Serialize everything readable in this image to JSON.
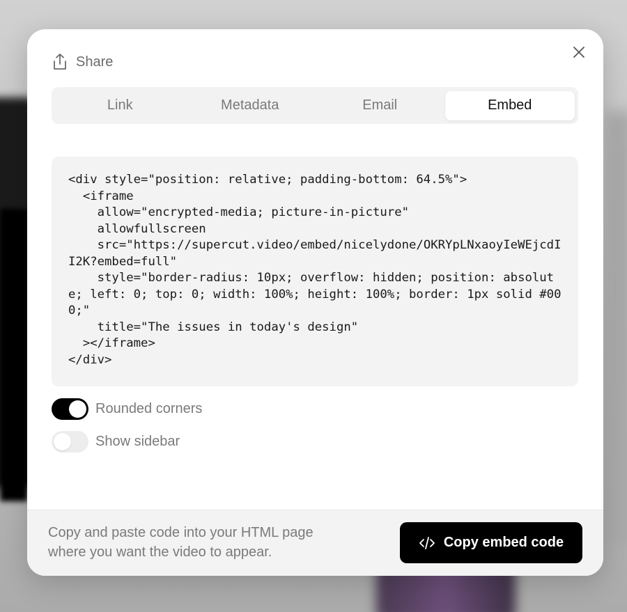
{
  "header": {
    "title": "Share",
    "icon": "share-icon"
  },
  "tabs": [
    {
      "label": "Link",
      "active": false
    },
    {
      "label": "Metadata",
      "active": false
    },
    {
      "label": "Email",
      "active": false
    },
    {
      "label": "Embed",
      "active": true
    }
  ],
  "embed": {
    "code": "<div style=\"position: relative; padding-bottom: 64.5%\">\n  <iframe\n    allow=\"encrypted-media; picture-in-picture\"\n    allowfullscreen\n    src=\"https://supercut.video/embed/nicelydone/OKRYpLNxaoyIeWEjcdII2K?embed=full\"\n    style=\"border-radius: 10px; overflow: hidden; position: absolute; left: 0; top: 0; width: 100%; height: 100%; border: 1px solid #000;\"\n    title=\"The issues in today's design\"\n  ></iframe>\n</div>"
  },
  "options": {
    "rounded_corners": {
      "label": "Rounded corners",
      "enabled": true
    },
    "show_sidebar": {
      "label": "Show sidebar",
      "enabled": false
    }
  },
  "footer": {
    "hint": "Copy and paste code into your HTML page where you want the video to appear.",
    "copy_label": "Copy embed code"
  },
  "colors": {
    "accent": "#000000",
    "muted_text": "#7a7a7a",
    "panel_bg": "#f3f3f3"
  }
}
